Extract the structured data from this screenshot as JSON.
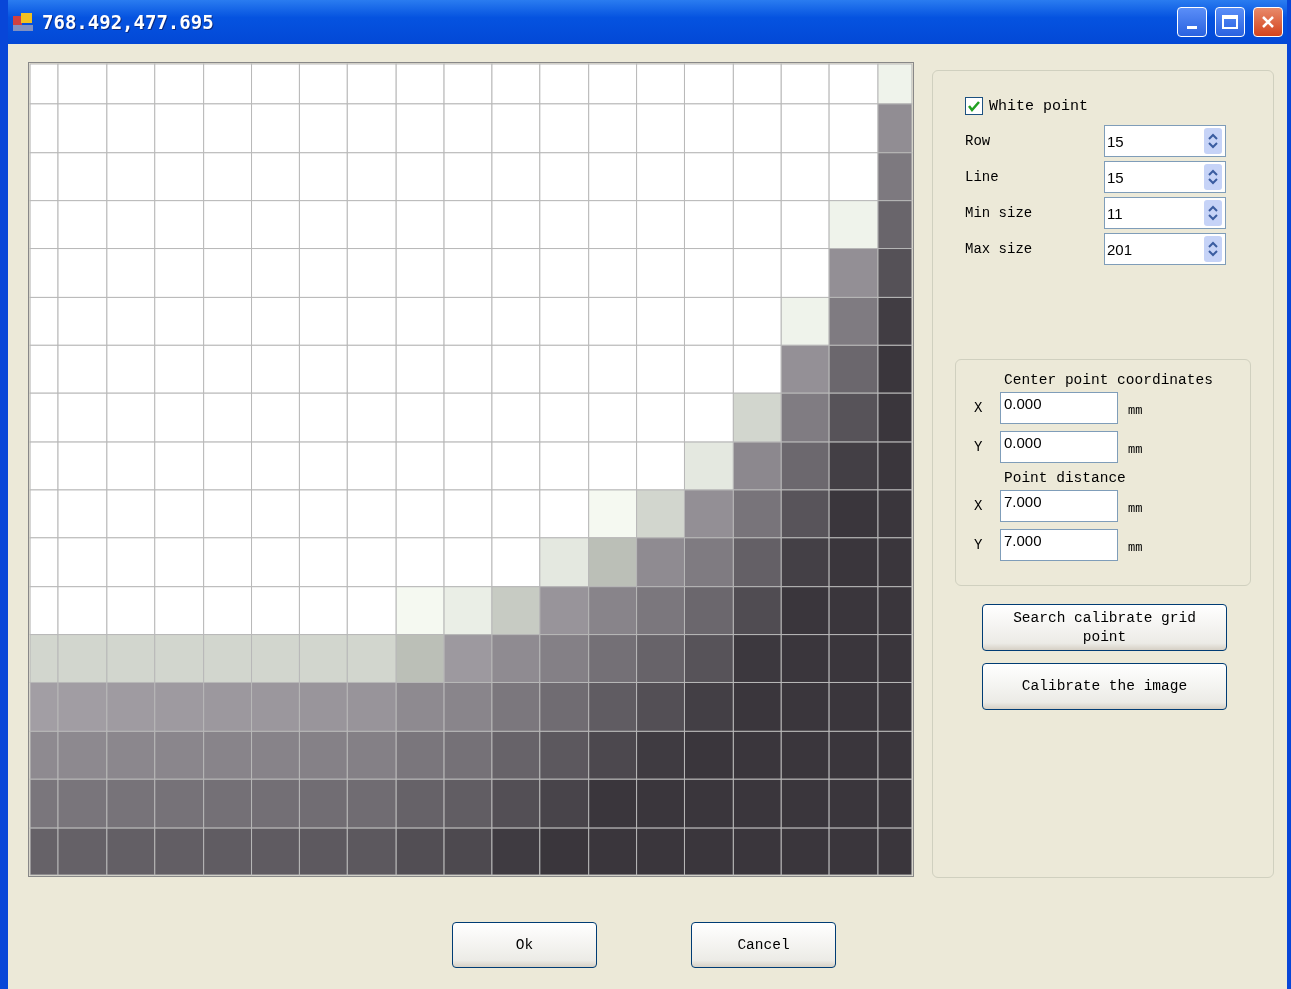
{
  "window": {
    "title": "768.492,477.695"
  },
  "white_point": {
    "label": "White point",
    "checked": true
  },
  "spinners": [
    {
      "label": "Row",
      "value": "15"
    },
    {
      "label": "Line",
      "value": "15"
    },
    {
      "label": "Min size",
      "value": "11"
    },
    {
      "label": "Max size",
      "value": "201"
    }
  ],
  "center_point": {
    "title": "Center point coordinates",
    "fields": [
      {
        "axis": "X",
        "value": "0.000",
        "unit": "mm"
      },
      {
        "axis": "Y",
        "value": "0.000",
        "unit": "mm"
      }
    ]
  },
  "point_distance": {
    "title": "Point distance",
    "fields": [
      {
        "axis": "X",
        "value": "7.000",
        "unit": "mm"
      },
      {
        "axis": "Y",
        "value": "7.000",
        "unit": "mm"
      }
    ]
  },
  "action_buttons": [
    "Search calibrate grid point",
    "Calibrate the image"
  ],
  "dialog_buttons": [
    "Ok",
    "Cancel"
  ]
}
